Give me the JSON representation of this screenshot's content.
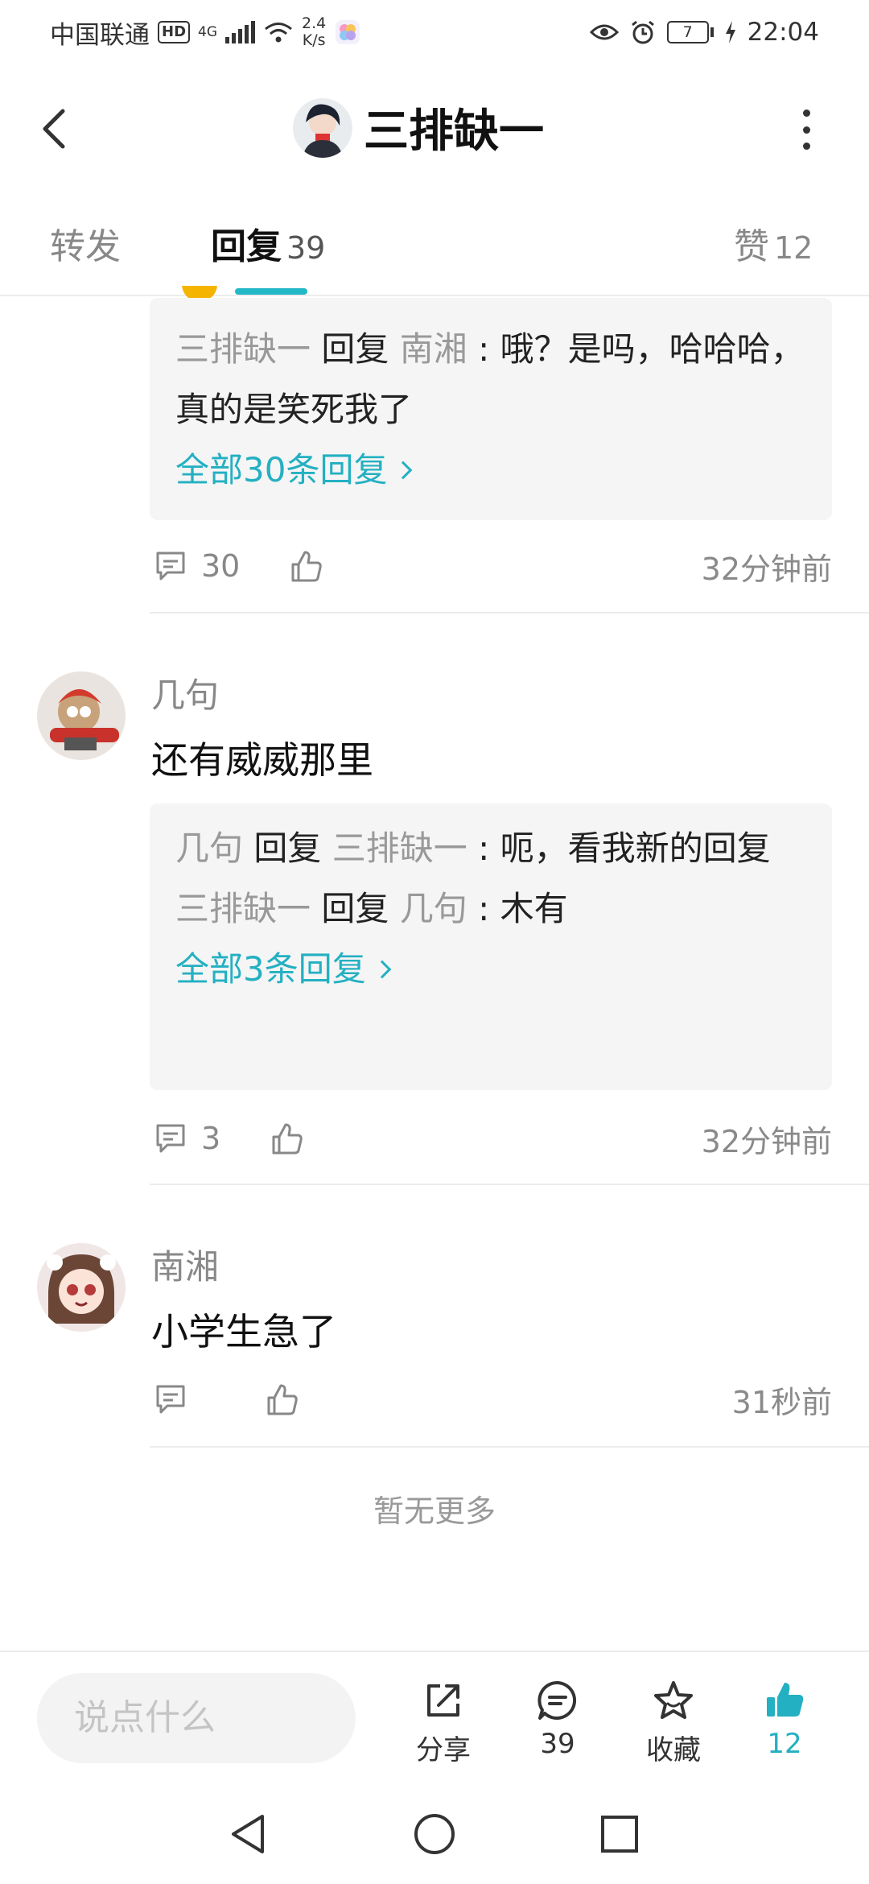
{
  "status_bar": {
    "carrier": "中国联通",
    "hd": "HD",
    "network": "4G",
    "speed_value": "2.4",
    "speed_unit": "K/s",
    "battery": "7",
    "time": "22:04"
  },
  "header": {
    "title": "三排缺一"
  },
  "tabs": {
    "forward": "转发",
    "reply": "回复",
    "reply_count": "39",
    "like": "赞",
    "like_count": "12"
  },
  "comments": [
    {
      "replies": [
        {
          "user": "三排缺一",
          "verb": "回复",
          "target": "南湘",
          "text": "哦？是吗，哈哈哈，真的是笑死我了"
        }
      ],
      "more_replies": "全部30条回复",
      "reply_count": "30",
      "time": "32分钟前"
    },
    {
      "name": "几句",
      "text": "还有威威那里",
      "replies": [
        {
          "user": "几句",
          "verb": "回复",
          "target": "三排缺一",
          "text": "呃，看我新的回复"
        },
        {
          "user": "三排缺一",
          "verb": "回复",
          "target": "几句",
          "text": "木有"
        }
      ],
      "more_replies": "全部3条回复",
      "reply_count": "3",
      "time": "32分钟前"
    },
    {
      "name": "南湘",
      "text": "小学生急了",
      "time": "31秒前"
    }
  ],
  "no_more": "暂无更多",
  "bottom_bar": {
    "input_placeholder": "说点什么",
    "share": "分享",
    "comments": "39",
    "favorite": "收藏",
    "likes": "12"
  },
  "colors": {
    "accent": "#23b0c2",
    "reply_box_bg": "#f5f5f5"
  }
}
